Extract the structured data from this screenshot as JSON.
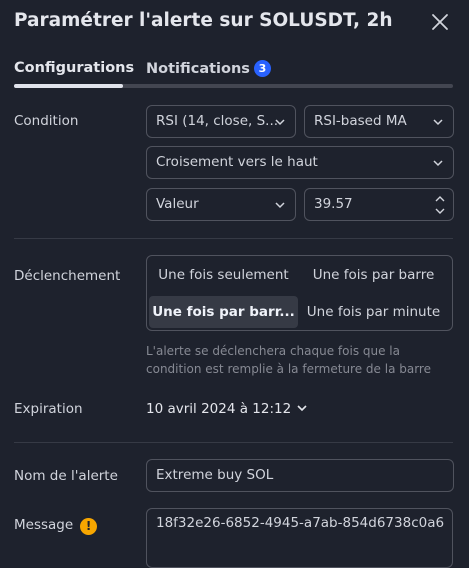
{
  "dialog": {
    "title": "Paramétrer l'alerte sur SOLUSDT, 2h"
  },
  "tabs": [
    {
      "label": "Configurations",
      "active": true
    },
    {
      "label": "Notifications",
      "badge": "3",
      "active": false
    }
  ],
  "condition": {
    "label": "Condition",
    "indicator_select": "RSI (14, close, S...",
    "source_select": "RSI-based MA",
    "operator_select": "Croisement vers le haut",
    "value_type_select": "Valeur",
    "value_input": "39.57"
  },
  "trigger": {
    "label": "Déclenchement",
    "options": [
      {
        "label": "Une fois seulement",
        "selected": false
      },
      {
        "label": "Une fois par barre",
        "selected": false
      },
      {
        "label": "Une fois par barr...",
        "selected": true
      },
      {
        "label": "Une fois par minute",
        "selected": false
      }
    ],
    "help_text": "L'alerte se déclenchera chaque fois que la condition est remplie à la fermeture de la barre"
  },
  "expiration": {
    "label": "Expiration",
    "value": "10 avril 2024 à 12:12"
  },
  "alert_name": {
    "label": "Nom de l'alerte",
    "value": "Extreme buy SOL"
  },
  "message": {
    "label": "Message",
    "value": "18f32e26-6852-4945-a7ab-854d6738c0a6"
  },
  "icons": {
    "close": "close-icon",
    "dropdown": "chevron-down-icon",
    "stepper": "stepper-icon",
    "warning": "warning-icon"
  },
  "colors": {
    "background": "#1e222d",
    "text": "#d1d4dc",
    "muted_text": "#868993",
    "border": "#50535e",
    "accent_blue": "#2962ff",
    "warning": "#f7a600",
    "selected_option_bg": "#363a45"
  }
}
